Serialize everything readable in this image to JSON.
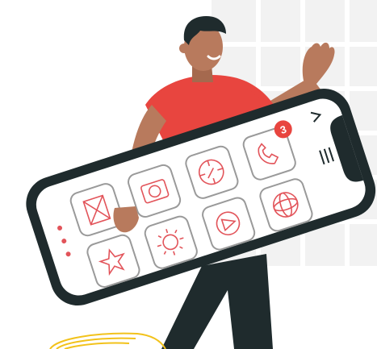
{
  "illustration": {
    "phone": {
      "badge": {
        "count": "3"
      },
      "apps": [
        {
          "name": "mail",
          "icon": "mail-icon"
        },
        {
          "name": "camera",
          "icon": "camera-icon"
        },
        {
          "name": "compass",
          "icon": "compass-icon"
        },
        {
          "name": "phone",
          "icon": "phone-call-icon",
          "badge": true
        },
        {
          "name": "star",
          "icon": "star-icon"
        },
        {
          "name": "brightness",
          "icon": "sun-icon"
        },
        {
          "name": "play",
          "icon": "play-icon"
        },
        {
          "name": "globe",
          "icon": "globe-icon"
        }
      ]
    },
    "colors": {
      "phone_frame": "#1f2b2d",
      "icon_stroke": "#e2545a",
      "shirt": "#e8453f",
      "skin": "#b87a5d",
      "pants": "#1f2b2d",
      "accent_yellow": "#f2c21b",
      "grid_background": "#efefef"
    }
  }
}
